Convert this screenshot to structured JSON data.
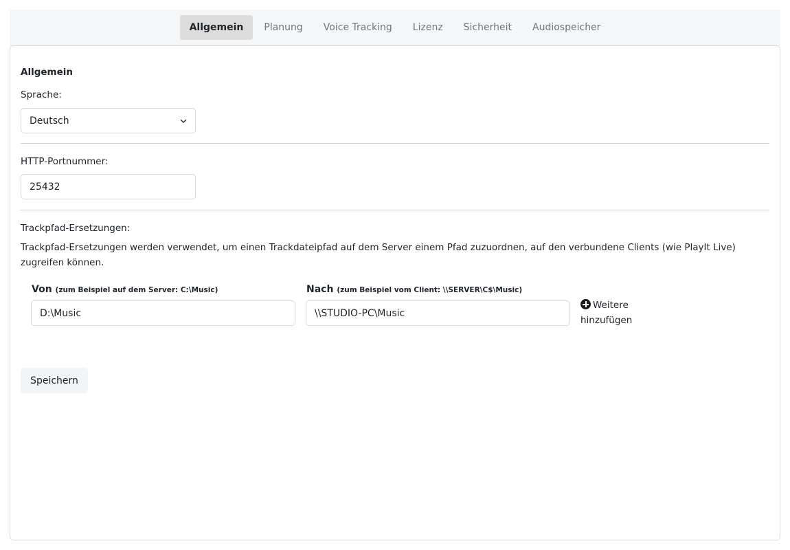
{
  "tabs": [
    {
      "label": "Allgemein",
      "active": true
    },
    {
      "label": "Planung",
      "active": false
    },
    {
      "label": "Voice Tracking",
      "active": false
    },
    {
      "label": "Lizenz",
      "active": false
    },
    {
      "label": "Sicherheit",
      "active": false
    },
    {
      "label": "Audiospeicher",
      "active": false
    }
  ],
  "general": {
    "title": "Allgemein",
    "language_label": "Sprache:",
    "language_value": "Deutsch",
    "port_label": "HTTP-Portnummer:",
    "port_value": "25432"
  },
  "path_replacements": {
    "label": "Trackpfad-Ersetzungen:",
    "description": "Trackpfad-Ersetzungen werden verwendet, um einen Trackdateipfad auf dem Server einem Pfad zuzuordnen, auf den verbundene Clients (wie PlayIt Live) zugreifen können.",
    "from_label": "Von",
    "from_hint": "(zum Beispiel auf dem Server: C:\\Music)",
    "to_label": "Nach",
    "to_hint": "(zum Beispiel vom Client: \\\\SERVER\\C$\\Music)",
    "from_value": "D:\\Music",
    "to_value": "\\\\STUDIO-PC\\Music",
    "add_more": "Weitere hinzufügen",
    "add_icon": "plus-circle-icon"
  },
  "save_label": "Speichern"
}
